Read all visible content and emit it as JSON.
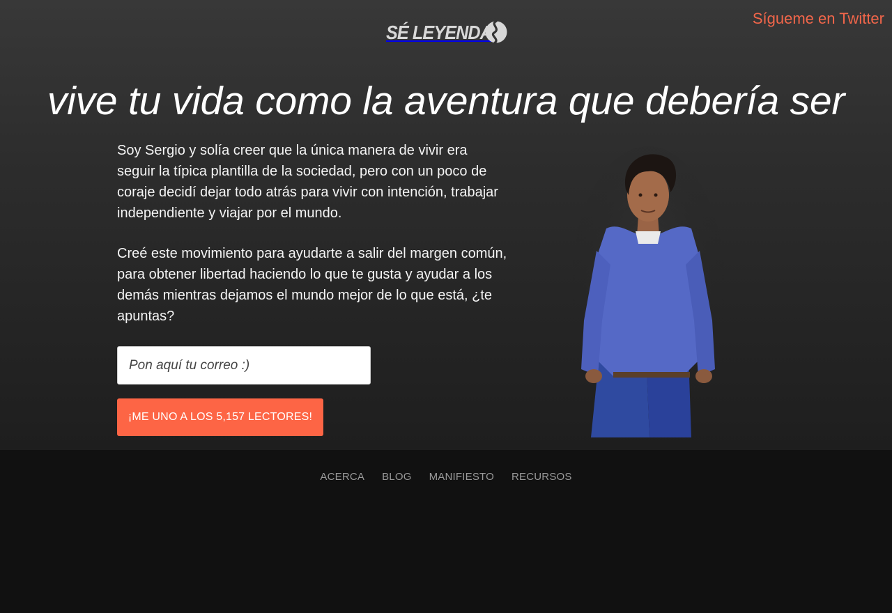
{
  "header": {
    "logo_text": "SÉ LEYENDA",
    "twitter_link": "Sígueme en Twitter"
  },
  "hero": {
    "headline": "vive tu vida como la aventura que debería ser",
    "paragraph_1": "Soy Sergio y solía creer que la única manera de vivir era seguir la típica plantilla de la sociedad, pero con un poco de coraje decidí dejar todo atrás para vivir con intención, trabajar independiente y viajar por el mundo.",
    "paragraph_2": "Creé este movimiento para ayudarte a salir del margen común, para obtener libertad haciendo lo que te gusta y ayudar a los demás mientras dejamos el mundo mejor de lo que está, ¿te apuntas?",
    "email_placeholder": "Pon aquí tu correo :)",
    "cta_label": "¡ME UNO A LOS 5,157 LECTORES!"
  },
  "footer": {
    "nav": [
      "ACERCA",
      "BLOG",
      "MANIFIESTO",
      "RECURSOS"
    ]
  },
  "colors": {
    "accent": "#fd6545",
    "twitter_link": "#f2664a",
    "footer_bg": "#111111",
    "nav_text": "#9a9a9a"
  }
}
